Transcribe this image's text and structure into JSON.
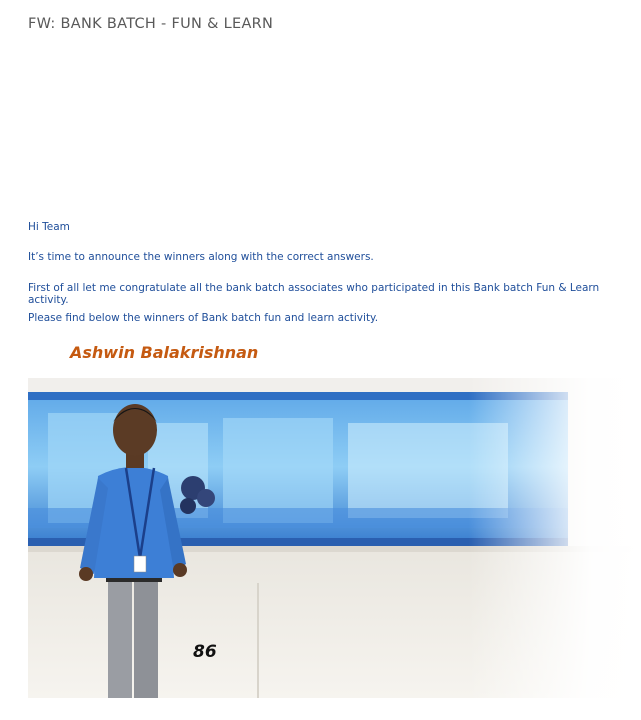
{
  "email": {
    "subject": "FW: BANK BATCH - FUN & LEARN",
    "greeting": "Hi Team",
    "paragraphs": [
      "It’s time to announce the winners along with the correct answers.",
      "First of all let me congratulate all the bank batch associates who participated in this Bank batch Fun & Learn activity.",
      "Please find below the winners of Bank batch fun and learn activity."
    ],
    "winner_name": "Ashwin Balakrishnan",
    "photo_number": "86"
  },
  "colors": {
    "subject": "#595959",
    "body_text": "#1f4e9a",
    "winner": "#c55a11"
  }
}
